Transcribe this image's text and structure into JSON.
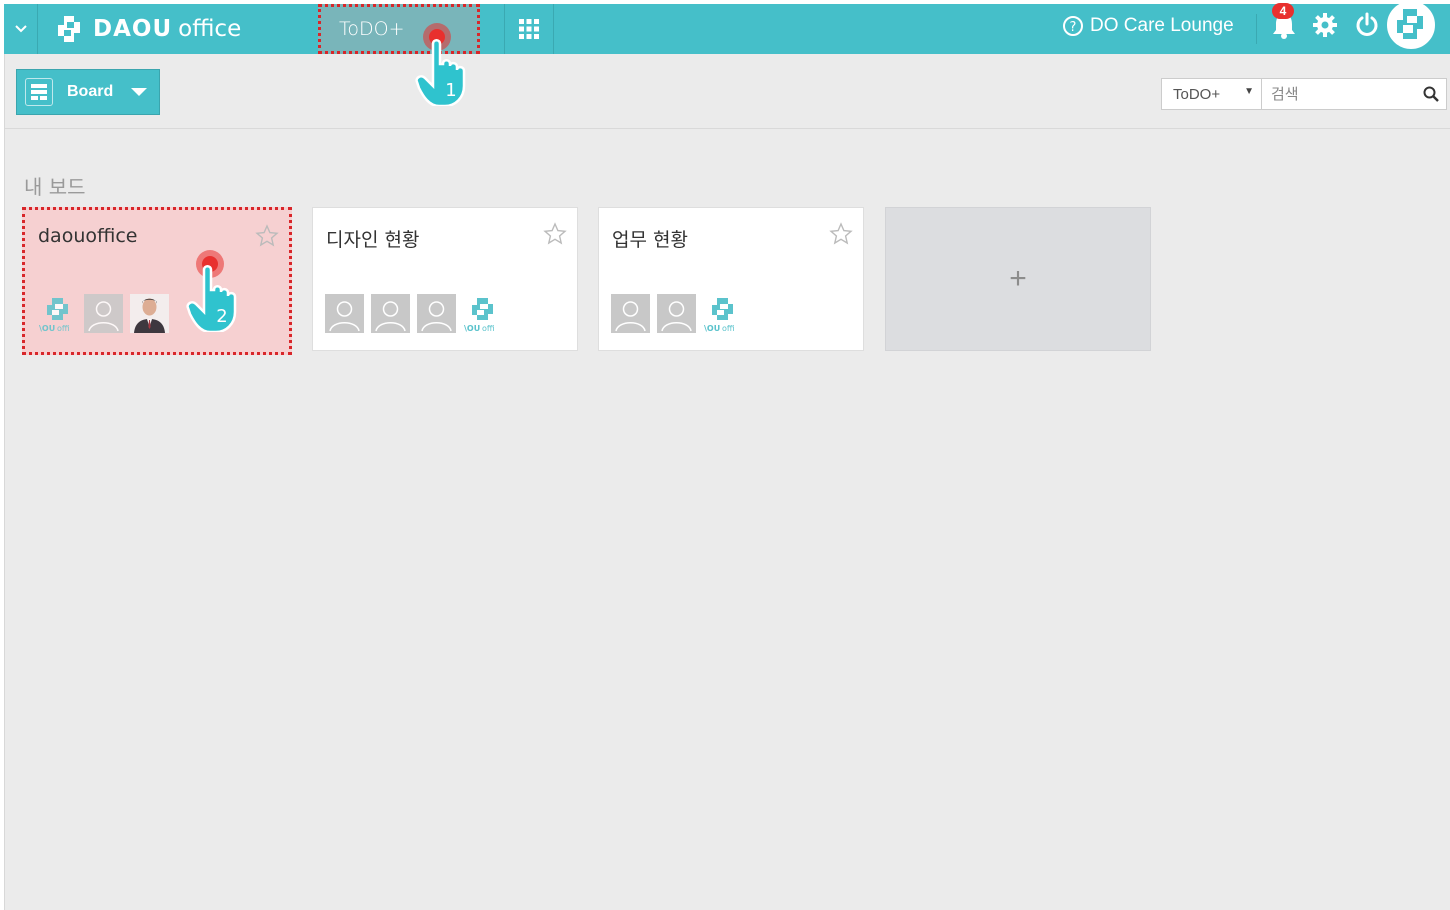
{
  "topbar": {
    "logo_bold": "DAOU",
    "logo_light": "office",
    "active_app": "ToDO+",
    "care_lounge": "DO Care Lounge",
    "notification_count": "4"
  },
  "toolbar": {
    "board_label": "Board",
    "search_scope": "ToDO+",
    "search_placeholder": "검색"
  },
  "section": {
    "title": "내 보드"
  },
  "boards": [
    {
      "title": "daouoffice",
      "starred": false,
      "members": [
        "daou-logo",
        "placeholder",
        "photo"
      ]
    },
    {
      "title": "디자인 현황",
      "starred": false,
      "members": [
        "placeholder",
        "placeholder",
        "placeholder",
        "daou-logo"
      ]
    },
    {
      "title": "업무 현황",
      "starred": false,
      "members": [
        "placeholder",
        "placeholder",
        "daou-logo"
      ]
    }
  ],
  "add_board": {
    "symbol": "+"
  },
  "annotations": {
    "step1": "1",
    "step2": "2"
  },
  "colors": {
    "accent": "#45bfc9",
    "highlight_border": "#d8262a",
    "highlight_fill": "#f6d0d1",
    "badge": "#e8302e"
  }
}
